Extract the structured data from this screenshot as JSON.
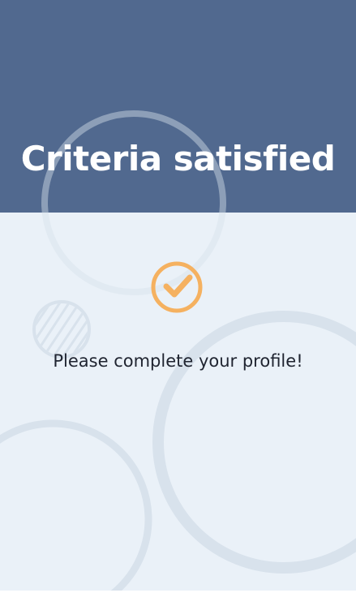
{
  "header": {
    "title": "Criteria satisfied"
  },
  "status": {
    "icon": "checkmark-circle-icon",
    "message": "Please complete your profile!"
  },
  "colors": {
    "header_background": "#51698f",
    "page_background": "#eaf1f8",
    "accent": "#f5b160",
    "decor_circles": "#d8e2ec",
    "title_text": "#ffffff",
    "body_text": "#1f2430"
  }
}
